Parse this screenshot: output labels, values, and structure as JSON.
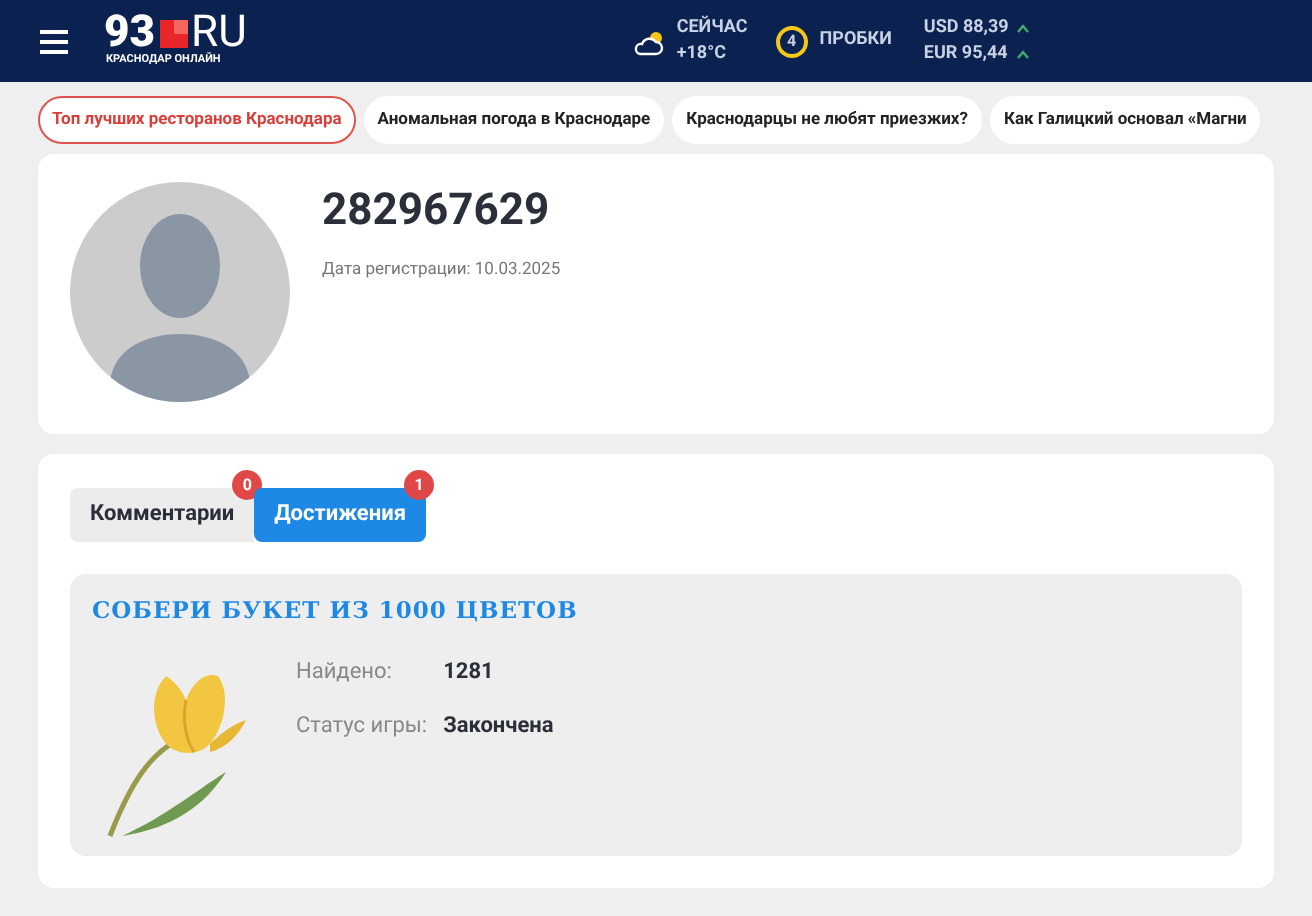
{
  "header": {
    "logo": {
      "number": "93",
      "domain": "RU",
      "tagline": "КРАСНОДАР ОНЛАЙН"
    },
    "weather": {
      "label": "СЕЙЧАС",
      "temperature": "+18°C"
    },
    "traffic": {
      "score": "4",
      "label": "ПРОБКИ"
    },
    "currencies": [
      {
        "text": "USD 88,39"
      },
      {
        "text": "EUR 95,44"
      }
    ]
  },
  "news_tags": [
    {
      "text": "Топ лучших ресторанов Краснодара",
      "selected": true
    },
    {
      "text": "Аномальная погода в Краснодаре",
      "selected": false
    },
    {
      "text": "Краснодарцы не любят приезжих?",
      "selected": false
    },
    {
      "text": "Как Галицкий основал «Магни",
      "selected": false
    }
  ],
  "profile": {
    "username": "282967629",
    "registration": "Дата регистрации: 10.03.2025"
  },
  "tabs": [
    {
      "label": "Комментарии",
      "count": "0",
      "selected": false
    },
    {
      "label": "Достижения",
      "count": "1",
      "selected": true
    }
  ],
  "achievement": {
    "title": "СОБЕРИ БУКЕТ ИЗ 1000 ЦВЕТОВ",
    "fields": [
      {
        "label": "Найдено:",
        "value": "1281"
      },
      {
        "label": "Статус игры:",
        "value": "Закончена"
      }
    ]
  }
}
